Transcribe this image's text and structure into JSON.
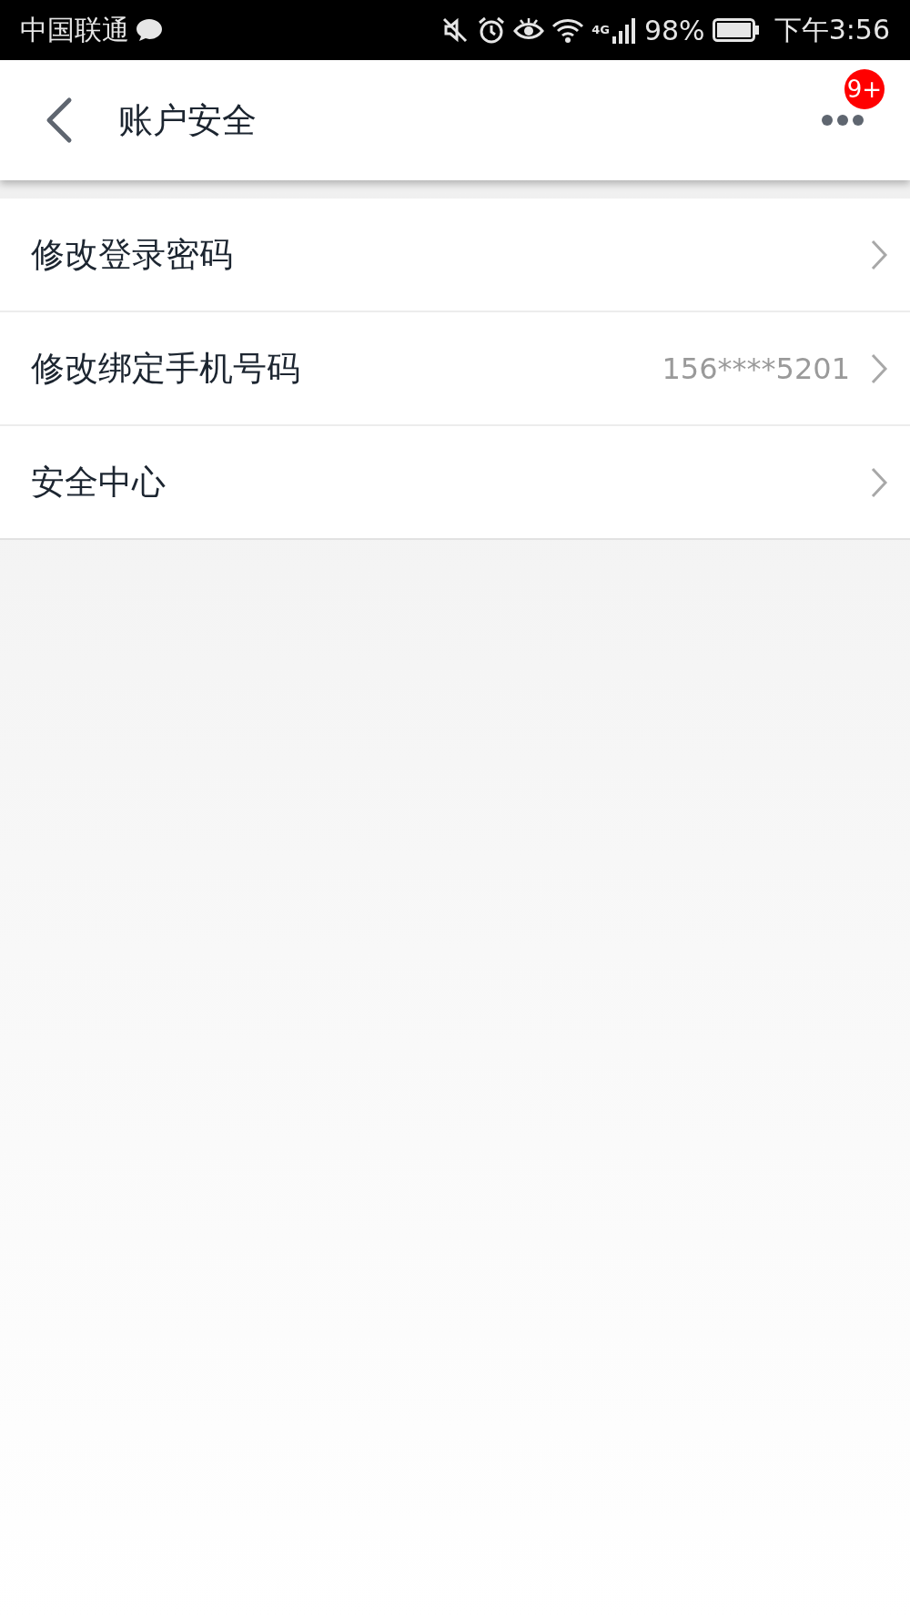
{
  "status_bar": {
    "carrier": "中国联通",
    "network_type": "4G",
    "battery": "98%",
    "time": "下午3:56"
  },
  "header": {
    "title": "账户安全",
    "badge": "9+"
  },
  "items": [
    {
      "label": "修改登录密码"
    },
    {
      "label": "修改绑定手机号码",
      "value": "156****5201"
    },
    {
      "label": "安全中心"
    }
  ]
}
